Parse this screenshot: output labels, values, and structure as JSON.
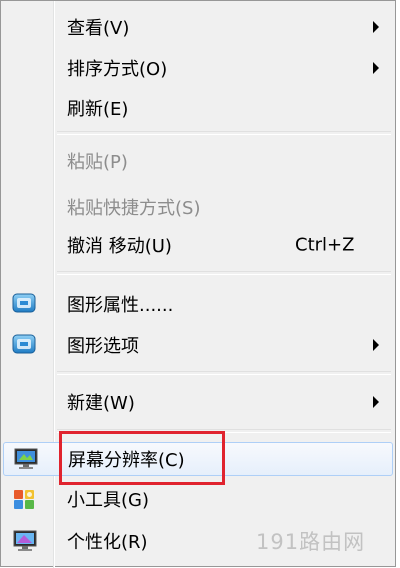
{
  "menu": {
    "items": [
      {
        "label": "查看(V)",
        "submenu": true
      },
      {
        "label": "排序方式(O)",
        "submenu": true
      },
      {
        "label": "刷新(E)"
      },
      {
        "label": "粘贴(P)",
        "disabled": true
      },
      {
        "label": "粘贴快捷方式(S)",
        "disabled": true
      },
      {
        "label": "撤消 移动(U)",
        "shortcut": "Ctrl+Z"
      },
      {
        "label": "图形属性......",
        "icon": "intel-graphics-icon"
      },
      {
        "label": "图形选项",
        "icon": "intel-graphics-icon",
        "submenu": true
      },
      {
        "label": "新建(W)",
        "submenu": true
      },
      {
        "label": "屏幕分辨率(C)",
        "icon": "screen-resolution-icon",
        "highlighted": true
      },
      {
        "label": "小工具(G)",
        "icon": "gadgets-icon"
      },
      {
        "label": "个性化(R)",
        "icon": "personalize-icon"
      }
    ]
  },
  "colors": {
    "highlight_box": "#e0232e",
    "hover_border": "#aecff7",
    "disabled_text": "#8d8d8d"
  },
  "watermark": {
    "text": "191路由网"
  }
}
